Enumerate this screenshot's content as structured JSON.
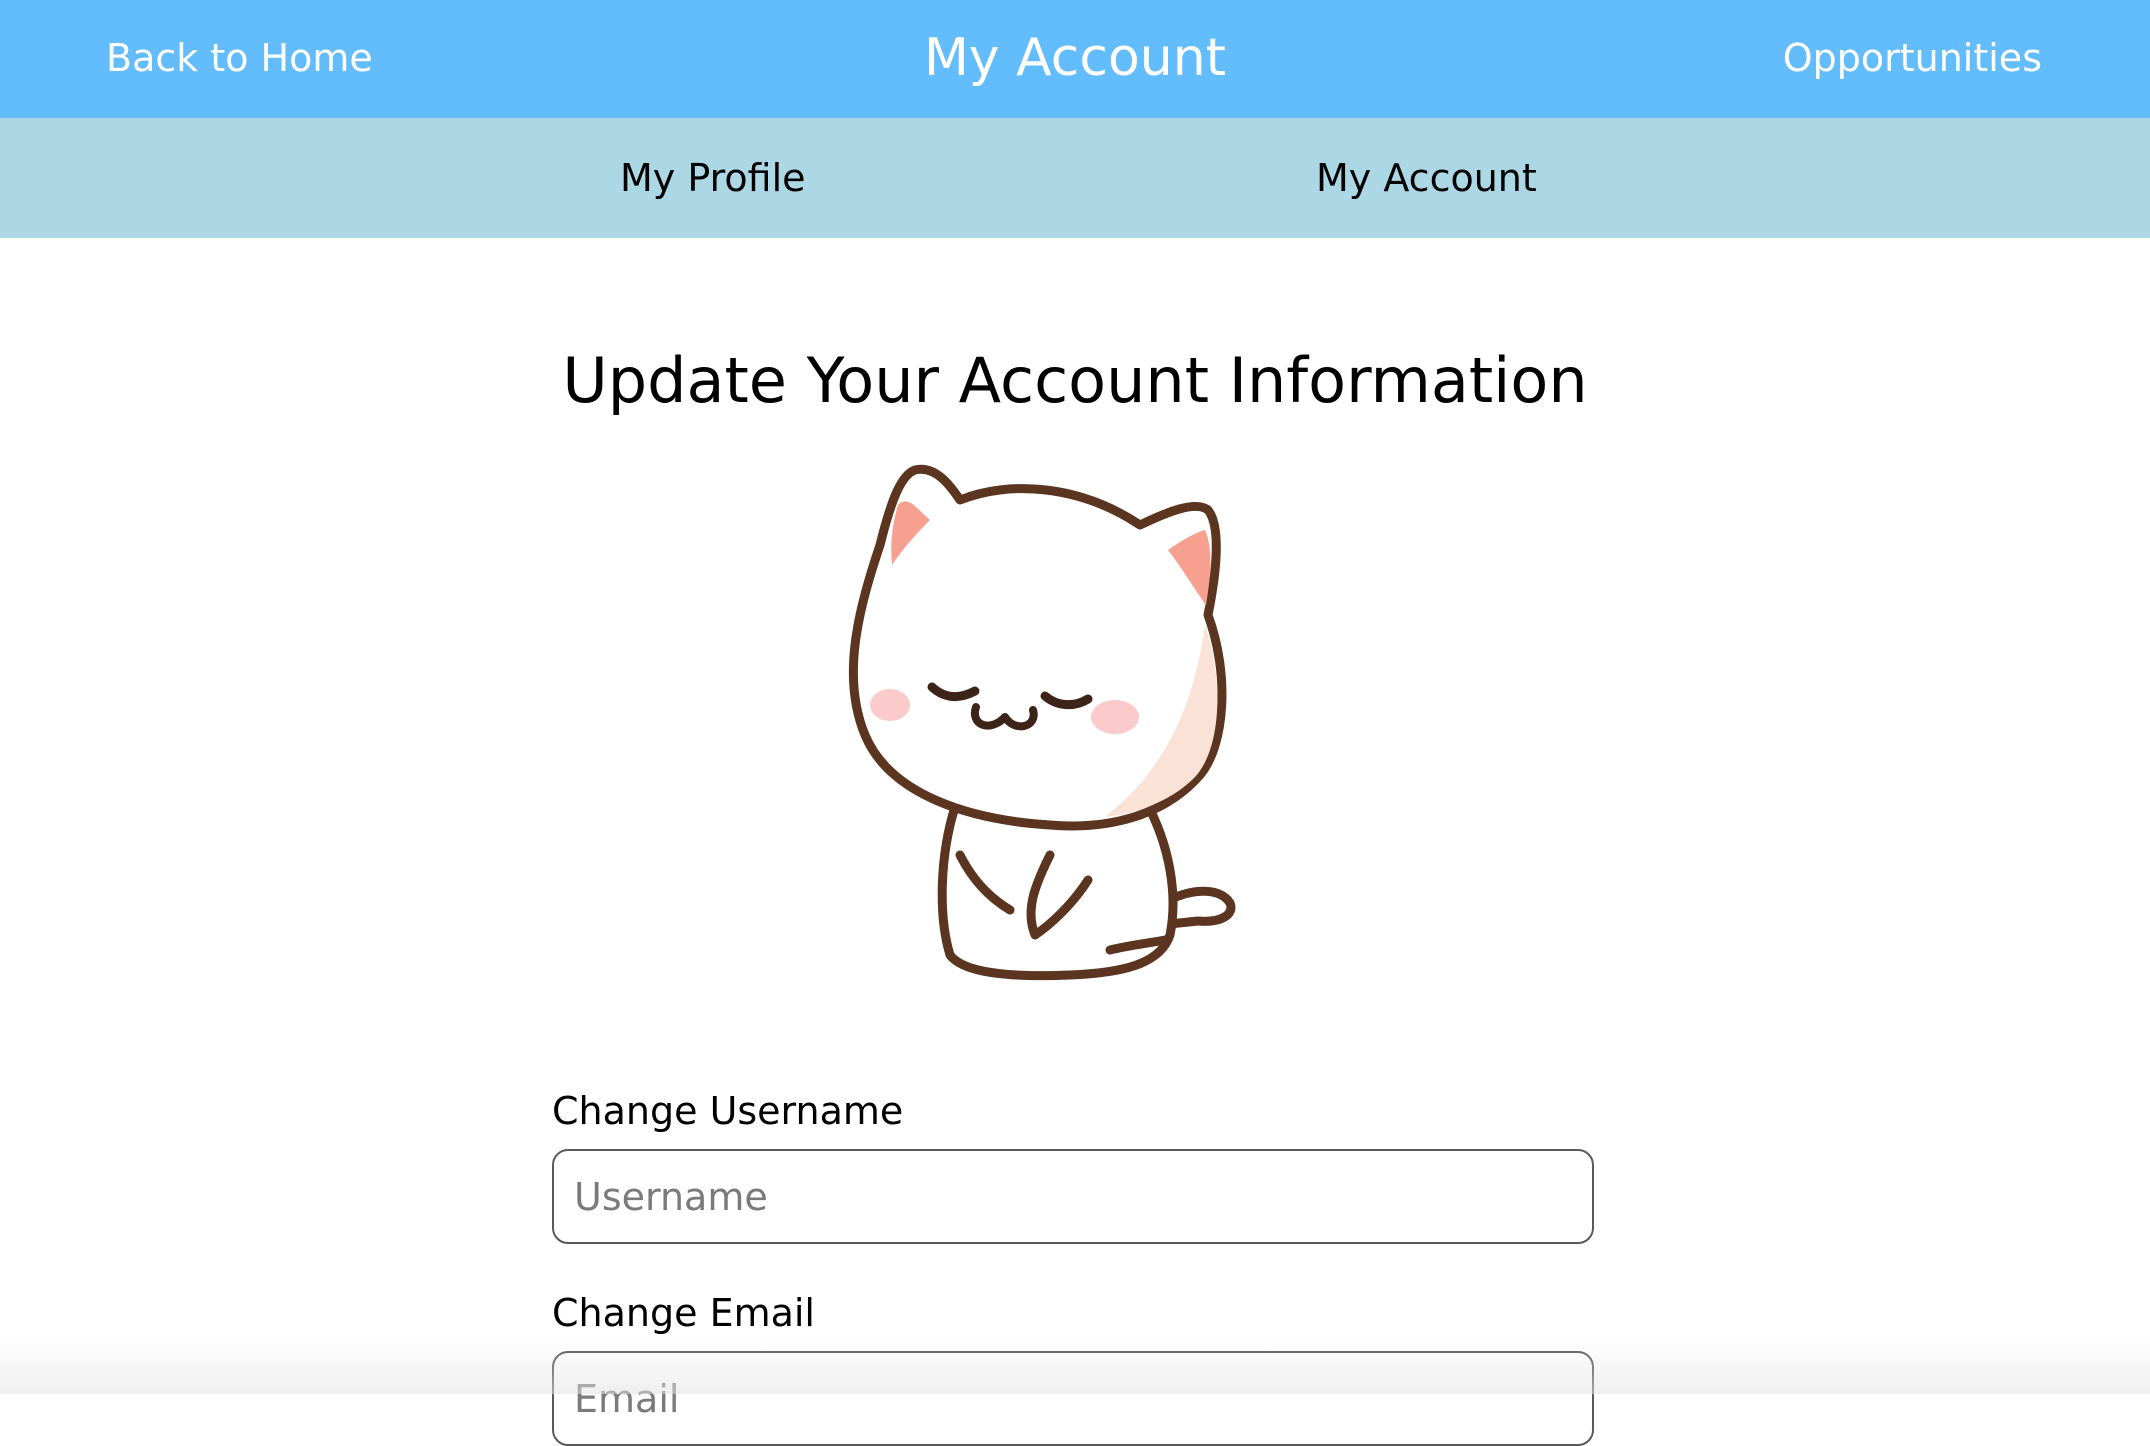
{
  "header": {
    "back_label": "Back to Home",
    "title": "My Account",
    "opportunities_label": "Opportunities",
    "background_color": "#63bdfc"
  },
  "subnav": {
    "tabs": [
      {
        "label": "My Profile"
      },
      {
        "label": "My Account"
      }
    ],
    "background_color": "#acd8e6"
  },
  "main": {
    "heading": "Update Your Account Information",
    "illustration": "sleepy-cat-icon",
    "fields": [
      {
        "label": "Change Username",
        "placeholder": "Username",
        "value": ""
      },
      {
        "label": "Change Email",
        "placeholder": "Email",
        "value": ""
      }
    ]
  }
}
